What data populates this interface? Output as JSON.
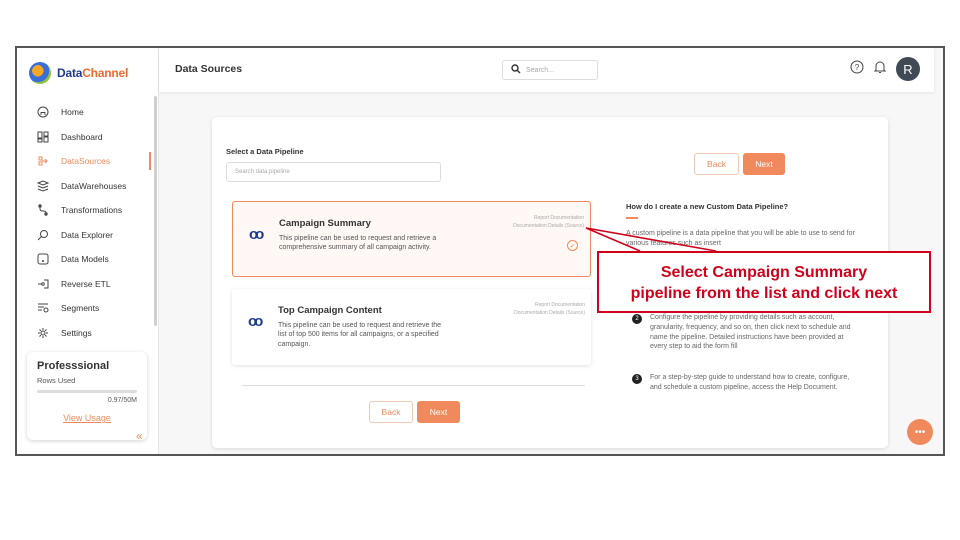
{
  "brand": {
    "name_primary": "Data",
    "name_accent": "Channel"
  },
  "sidebar": {
    "items": [
      {
        "label": "Home",
        "icon": "home-icon"
      },
      {
        "label": "Dashboard",
        "icon": "dashboard-icon"
      },
      {
        "label": "DataSources",
        "icon": "datasources-icon",
        "active": true
      },
      {
        "label": "DataWarehouses",
        "icon": "database-icon"
      },
      {
        "label": "Transformations",
        "icon": "transform-icon"
      },
      {
        "label": "Data Explorer",
        "icon": "explorer-icon"
      },
      {
        "label": "Data Models",
        "icon": "models-icon"
      },
      {
        "label": "Reverse ETL",
        "icon": "reverse-etl-icon"
      },
      {
        "label": "Segments",
        "icon": "segments-icon"
      },
      {
        "label": "Settings",
        "icon": "settings-icon"
      }
    ],
    "plan": {
      "title": "Professsional",
      "rows_label": "Rows Used",
      "rows_value": "0.97/50M",
      "usage_fraction": 0.02,
      "view_usage": "View Usage"
    }
  },
  "header": {
    "title": "Data Sources",
    "search_placeholder": "Search...",
    "avatar_initial": "R"
  },
  "main": {
    "select_label": "Select a Data Pipeline",
    "search_placeholder": "Search data pipeline",
    "back_label": "Back",
    "next_label": "Next",
    "pipelines": [
      {
        "name": "Campaign Summary",
        "logo": "oo",
        "description": "This pipeline can be used to request and retrieve a comprehensive summary of all campaign activity.",
        "meta_1": "Report Documentation",
        "meta_2": "Documentation Details (Source)",
        "selected": true
      },
      {
        "name": "Top Campaign Content",
        "logo": "oo",
        "description": "This pipeline can be used to request and retrieve the list of top 500 items for all campaigns, or a specified campaign.",
        "meta_1": "Report Documentation",
        "meta_2": "Documentation Details (Source)",
        "selected": false
      }
    ],
    "help": {
      "title": "How do I create a new Custom Data Pipeline?",
      "intro": "A custom pipeline is a data pipeline that you will be able to use to send for various features such as insert",
      "step_2": "Configure the pipeline by providing details such as account, granularity, frequency, and so on, then click next to schedule and name the pipeline. Detailed instructions have been provided at every step to aid the form fill",
      "step_3": "For a step-by-step guide to understand how to create, configure, and schedule a custom pipeline, access the Help Document.",
      "step_2_num": "2",
      "step_3_num": "3"
    }
  },
  "callout": {
    "line_1": "Select Campaign Summary",
    "line_2": "pipeline from the list and click next"
  },
  "colors": {
    "accent": "#f08a5d",
    "callout": "#d0021b",
    "brand": "#1f3b8c"
  }
}
